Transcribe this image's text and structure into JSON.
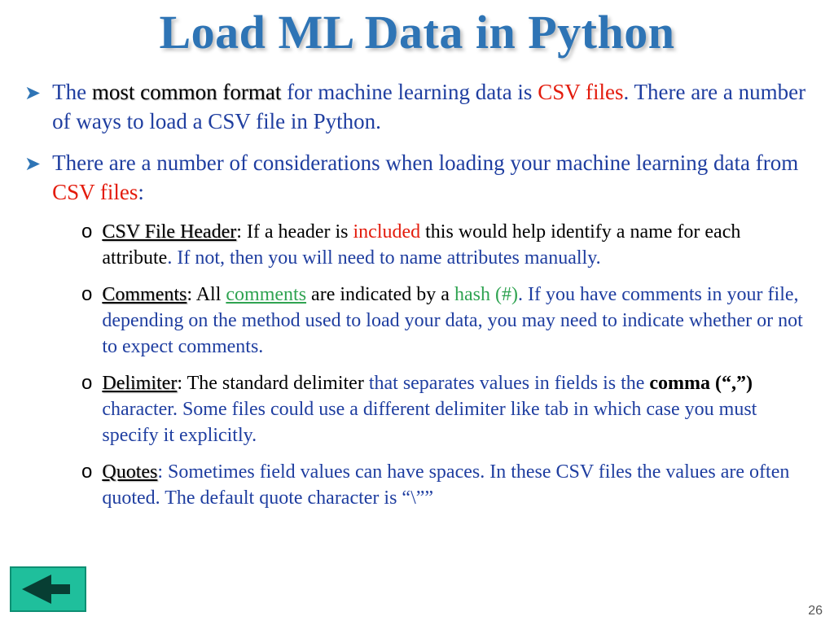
{
  "title": "Load ML Data in Python",
  "pageNumber": "26",
  "bullets": {
    "b1": {
      "p1": "The ",
      "emph": "most common format",
      "p2": " for machine learning data is ",
      "csv": "CSV files",
      "p3": ". There are a number of ways to load a CSV file in Python."
    },
    "b2": {
      "p1": "There are a number of considerations when loading your machine learning data from ",
      "csv": "CSV files",
      "p2": ":"
    }
  },
  "sub": {
    "s1": {
      "label": "CSV File Header",
      "p1": ": If a header is ",
      "inc": "included",
      "p2": " this would ",
      "help": "help identify a name for each attribute",
      "p3": ". If not, then you will need to name attributes manually."
    },
    "s2": {
      "label": "Comments",
      "p1": ": All ",
      "comments_link": "comments",
      "p2": " are indicated by a ",
      "hash": "hash (#)",
      "p3": ". If you have comments in your file, depending on the method used to load your data, you may need to indicate whether or not to expect comments."
    },
    "s3": {
      "label": "Delimiter",
      "p1": ": The ",
      "std": "standard delimiter",
      "p2": " that separates values in fields is the ",
      "comma": "comma (“,”)",
      "p3": " character. Some files could use a different delimiter like tab in which case you must specify it explicitly."
    },
    "s4": {
      "label": "Quotes",
      "p1": ": Sometimes field values can have spaces. In these CSV files the values are often quoted. The default quote character is “\\””"
    }
  }
}
